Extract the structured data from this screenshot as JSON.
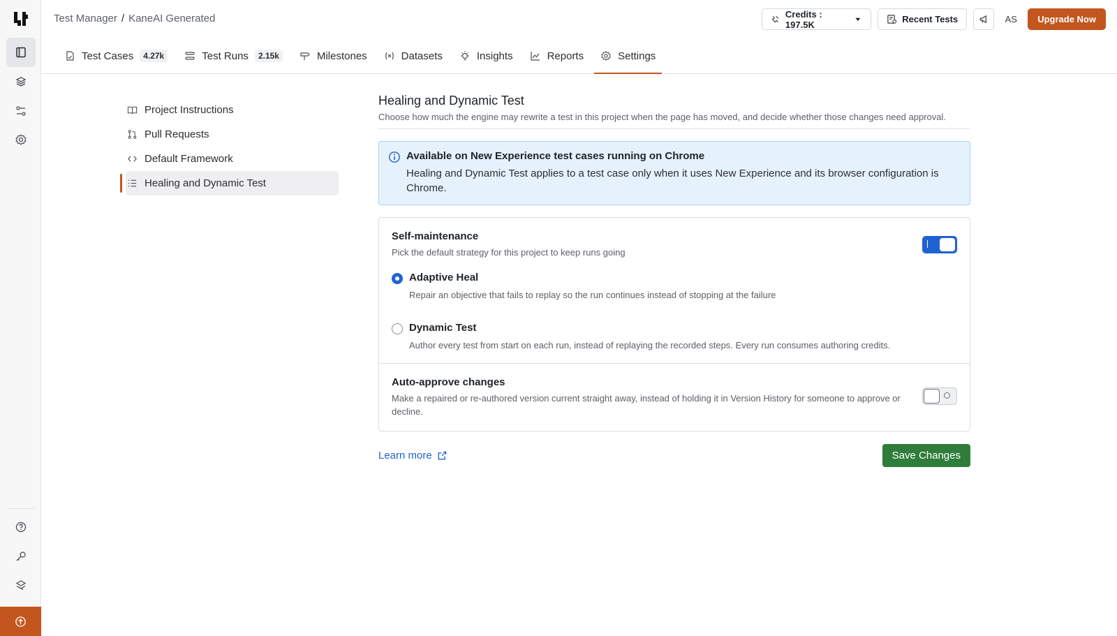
{
  "rail": {
    "items": [
      "book-icon",
      "layers-icon",
      "sliders-icon",
      "gear-icon"
    ],
    "bottom_items": [
      "help-icon",
      "key-icon",
      "integrations-icon"
    ],
    "footer_icon": "upgrade-circle-icon"
  },
  "breadcrumb": {
    "root": "Test Manager",
    "separator": "/",
    "current": "KaneAI Generated"
  },
  "top_actions": {
    "credits": "Credits : 197.5K",
    "recent_tests": "Recent Tests",
    "avatar": "AS",
    "upgrade": "Upgrade Now"
  },
  "tabs": [
    {
      "label": "Test Cases",
      "count": "4.27k"
    },
    {
      "label": "Test Runs",
      "count": "2.15k"
    },
    {
      "label": "Milestones"
    },
    {
      "label": "Datasets"
    },
    {
      "label": "Insights"
    },
    {
      "label": "Reports"
    },
    {
      "label": "Settings",
      "active": true
    }
  ],
  "settings_nav": [
    {
      "label": "Project Instructions"
    },
    {
      "label": "Pull Requests"
    },
    {
      "label": "Default Framework"
    },
    {
      "label": "Healing and Dynamic Test",
      "active": true
    }
  ],
  "main": {
    "title": "Healing and Dynamic Test",
    "subtitle": "Choose how much the engine may rewrite a test in this project when the page has moved, and decide whether those changes need approval.",
    "info": {
      "title": "Available on New Experience test cases running on Chrome",
      "body": "Healing and Dynamic Test applies to a test case only when it uses New Experience and its browser configuration is Chrome."
    },
    "self_maintenance": {
      "title": "Self-maintenance",
      "desc": "Pick the default strategy for this project to keep runs going",
      "enabled": true,
      "options": [
        {
          "label": "Adaptive Heal",
          "desc": "Repair an objective that fails to replay so the run continues instead of stopping at the failure",
          "selected": true
        },
        {
          "label": "Dynamic Test",
          "desc": "Author every test from start on each run, instead of replaying the recorded steps. Every run consumes authoring credits.",
          "selected": false
        }
      ]
    },
    "auto_approve": {
      "title": "Auto-approve changes",
      "desc": "Make a repaired or re-authored version current straight away, instead of holding it in Version History for someone to approve or decline.",
      "enabled": false
    },
    "learn_more": "Learn more",
    "save": "Save Changes"
  },
  "colors": {
    "accent": "#c2561e",
    "primary": "#1f63d0",
    "save": "#2f7d3a",
    "info_bg": "#e6f2fb"
  }
}
